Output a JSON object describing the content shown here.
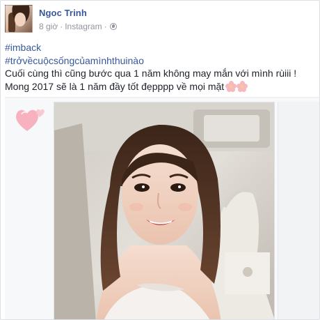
{
  "post": {
    "author_name": "Ngoc Trinh",
    "timestamp": "8 giờ",
    "separator": "·",
    "source": "Instagram",
    "privacy_icon": "globe-icon",
    "hashtag_1": "#imback",
    "hashtag_2": "#trởvềcuộcsốngcủamìnhthuinào",
    "line_1": "Cuối cùng thì cũng bước qua 1 năm không may mắn với mình rùiii !",
    "line_2": "Mong 2017 sẽ là 1 năm đầy tốt đẹpppp về mọi mặt",
    "emoji": "cherry-blossom-icon"
  },
  "colors": {
    "link_blue": "#365899",
    "text_dark": "#1d2129",
    "meta_gray": "#90949c",
    "blossom_pink": "#f7b8c0"
  }
}
